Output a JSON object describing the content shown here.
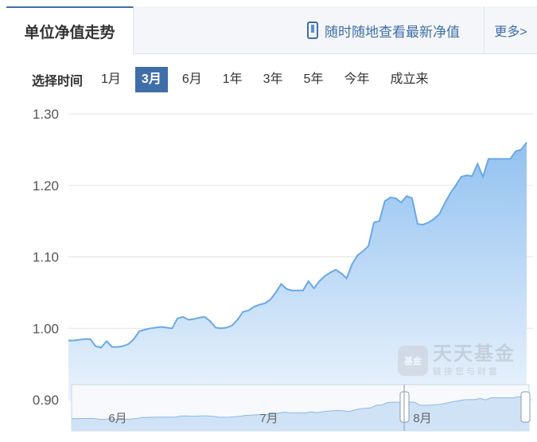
{
  "header": {
    "tab_title": "单位净值走势",
    "promo_text": "随时随地查看最新净值",
    "more_label": "更多>"
  },
  "range": {
    "label": "选择时间",
    "options": [
      "1月",
      "3月",
      "6月",
      "1年",
      "3年",
      "5年",
      "今年",
      "成立来"
    ],
    "active": "3月"
  },
  "watermark": {
    "logo_text": "基金",
    "title": "天天基金",
    "subtitle": "链接您与财富"
  },
  "colors": {
    "accent": "#3f6ea8",
    "line": "#6aa8e6",
    "area_top": "#92c1f0",
    "area_bottom": "#eaf3fc",
    "grid": "#e3e3e3"
  },
  "chart_data": {
    "type": "area",
    "title": "",
    "xlabel": "",
    "ylabel": "",
    "ylim": [
      0.9,
      1.3
    ],
    "yticks": [
      "1.30",
      "1.20",
      "1.10",
      "1.00",
      "0.90"
    ],
    "grid": true,
    "navigator_labels": [
      "6月",
      "7月",
      "8月"
    ],
    "series": [
      {
        "values": [
          0.983,
          0.983,
          0.984,
          0.985,
          0.985,
          0.975,
          0.973,
          0.982,
          0.974,
          0.974,
          0.975,
          0.978,
          0.985,
          0.996,
          0.998,
          1.0,
          1.001,
          1.002,
          1.001,
          1.0,
          1.014,
          1.016,
          1.012,
          1.013,
          1.015,
          1.016,
          1.01,
          1.001,
          1.0,
          1.001,
          1.004,
          1.012,
          1.023,
          1.025,
          1.03,
          1.033,
          1.035,
          1.04,
          1.05,
          1.062,
          1.055,
          1.053,
          1.053,
          1.053,
          1.066,
          1.056,
          1.066,
          1.073,
          1.078,
          1.082,
          1.077,
          1.07,
          1.09,
          1.102,
          1.108,
          1.115,
          1.148,
          1.15,
          1.178,
          1.183,
          1.182,
          1.176,
          1.185,
          1.182,
          1.146,
          1.145,
          1.148,
          1.153,
          1.16,
          1.175,
          1.189,
          1.2,
          1.212,
          1.214,
          1.213,
          1.23,
          1.212,
          1.237,
          1.237,
          1.237,
          1.237,
          1.237,
          1.248,
          1.25,
          1.26
        ]
      }
    ]
  }
}
